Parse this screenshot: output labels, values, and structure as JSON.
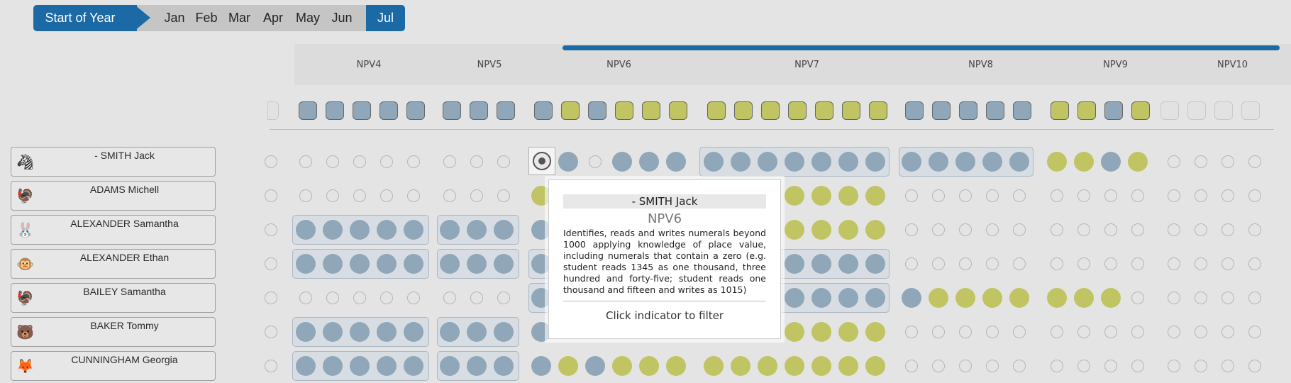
{
  "months": [
    {
      "label": "Start of Year",
      "active": true
    },
    {
      "label": "Jan",
      "active": false
    },
    {
      "label": "Feb",
      "active": false
    },
    {
      "label": "Mar",
      "active": false
    },
    {
      "label": "Apr",
      "active": false
    },
    {
      "label": "May",
      "active": false
    },
    {
      "label": "Jun",
      "active": false
    },
    {
      "label": "Jul",
      "active": true
    }
  ],
  "columns": [
    "NPV4",
    "NPV5",
    "NPV6",
    "NPV7",
    "NPV8",
    "NPV9",
    "NPV10"
  ],
  "indicator_squares": [
    {
      "group": "NPV4",
      "colors": [
        "blue",
        "blue",
        "blue",
        "blue",
        "blue"
      ]
    },
    {
      "group": "NPV5",
      "colors": [
        "blue",
        "blue",
        "blue"
      ]
    },
    {
      "group": "NPV6",
      "colors": [
        "blue",
        "yellow",
        "blue",
        "yellow",
        "yellow",
        "yellow"
      ]
    },
    {
      "group": "NPV7",
      "colors": [
        "yellow",
        "yellow",
        "yellow",
        "yellow",
        "yellow",
        "yellow",
        "yellow"
      ]
    },
    {
      "group": "NPV8",
      "colors": [
        "blue",
        "blue",
        "blue",
        "blue",
        "blue"
      ]
    },
    {
      "group": "NPV9",
      "colors": [
        "yellow",
        "yellow",
        "blue",
        "yellow"
      ]
    },
    {
      "group": "NPV10",
      "colors": [
        "empty",
        "empty",
        "empty",
        "empty"
      ]
    }
  ],
  "students": [
    {
      "name": "- SMITH Jack",
      "avatar": "🦓"
    },
    {
      "name": "ADAMS Michell",
      "avatar": "🦃"
    },
    {
      "name": "ALEXANDER Samantha",
      "avatar": "🐰"
    },
    {
      "name": "ALEXANDER Ethan",
      "avatar": "🐵"
    },
    {
      "name": "BAILEY Samantha",
      "avatar": "🦃"
    },
    {
      "name": "BAKER Tommy",
      "avatar": "🐻"
    },
    {
      "name": "CUNNINGHAM Georgia",
      "avatar": "🦊"
    }
  ],
  "tooltip": {
    "student": "- SMITH Jack",
    "code": "NPV6",
    "description": "Identifies, reads and writes numerals beyond 1000 applying knowledge of place value, including numerals that contain a zero (e.g. student reads 1345 as one thousand, three hundred and forty-five; student reads one thousand and fifteen and writes as 1015)",
    "filter_hint": "Click indicator to filter"
  },
  "colors": {
    "accent": "#1b6aa5",
    "blue": "#8fa7b8",
    "yellow": "#c1c462"
  }
}
